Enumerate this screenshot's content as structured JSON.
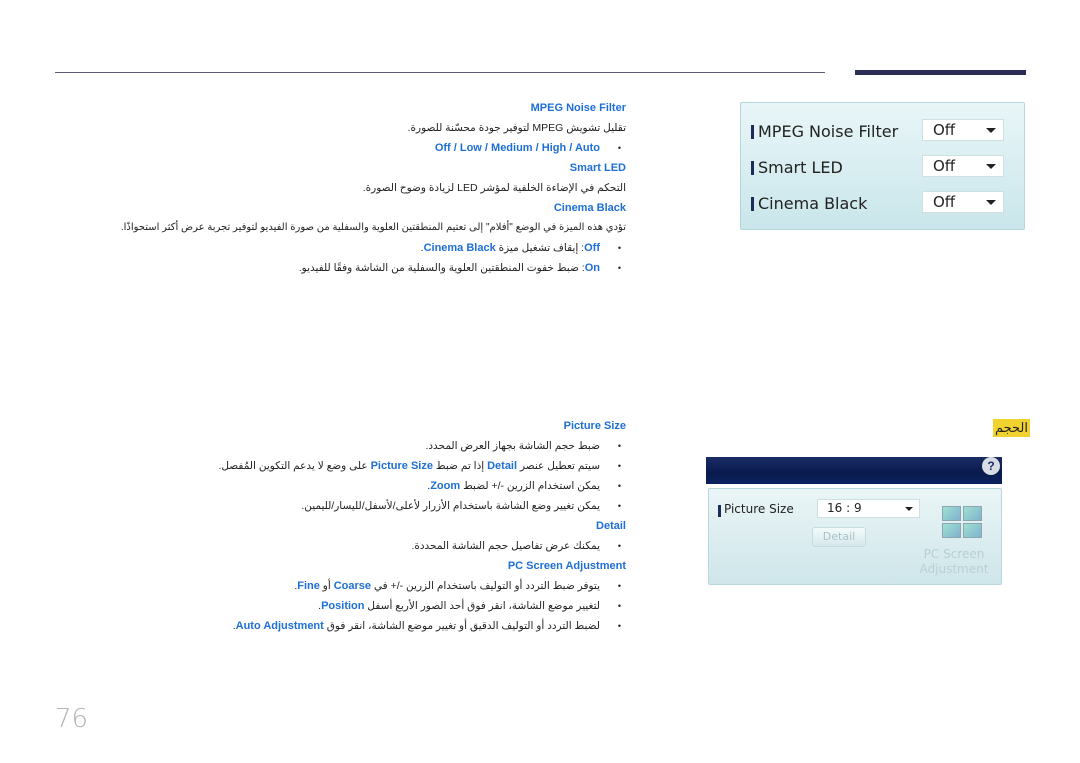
{
  "page_number": "76",
  "section1": {
    "mpeg_heading": "MPEG Noise Filter",
    "mpeg_desc": "تقليل تشويش MPEG لتوفير جودة محسّنة للصورة.",
    "mpeg_options": "Off / Low / Medium / High / Auto",
    "smart_led_heading": "Smart LED",
    "smart_led_desc": "التحكم في الإضاءة الخلفية لمؤشر LED لزيادة وضوح الصورة.",
    "cinema_black_heading": "Cinema Black",
    "cinema_black_desc": "تؤدي هذه الميزة في الوضع \"أفلام\" إلى تعتيم المنطقتين العلوية والسفلية من صورة الفيديو لتوفير تجربة عرض أكثر استحواذًا.",
    "cinema_off_key": "Off",
    "cinema_off_text": ": إيقاف تشغيل ميزة ",
    "cinema_off_feature": "Cinema Black",
    "cinema_on_key": "On",
    "cinema_on_text": ": ضبط خفوت المنطقتين العلوية والسفلية من الشاشة وفقًا للفيديو."
  },
  "panel1": {
    "rows": [
      {
        "label": "MPEG Noise Filter",
        "value": "Off"
      },
      {
        "label": "Smart LED",
        "value": "Off"
      },
      {
        "label": "Cinema Black",
        "value": "Off"
      }
    ]
  },
  "size_highlight": "الحجم",
  "panel2": {
    "help_label": "?",
    "picture_size_label": "Picture Size",
    "picture_size_value": "16 : 9",
    "detail_button": "Detail",
    "pc_screen_label_line1": "PC Screen",
    "pc_screen_label_line2": "Adjustment"
  },
  "section2": {
    "picture_size_heading": "Picture Size",
    "ps_bullet1": "ضبط حجم الشاشة بجهاز العرض المحدد.",
    "ps_bullet2_a": "سيتم تعطيل عنصر ",
    "ps_bullet2_detail": "Detail",
    "ps_bullet2_b": " إذا تم ضبط ",
    "ps_bullet2_ps": "Picture Size",
    "ps_bullet2_c": " على وضع لا يدعم التكوين المُفصل.",
    "ps_bullet3_a": "يمكن استخدام الزرين -/+ لضبط ",
    "ps_bullet3_zoom": "Zoom",
    "ps_bullet4": "يمكن تغيير وضع الشاشة باستخدام الأزرار لأعلى/لأسفل/لليسار/لليمين.",
    "detail_heading": "Detail",
    "detail_bullet1": "يمكنك عرض تفاصيل حجم الشاشة المحددة.",
    "pcsa_heading": "PC Screen Adjustment",
    "pcsa_bullet1_a": "يتوفر ضبط التردد أو التوليف باستخدام الزرين -/+ في ",
    "pcsa_bullet1_coarse": "Coarse",
    "pcsa_bullet1_or": " أو ",
    "pcsa_bullet1_fine": "Fine",
    "pcsa_bullet2_a": "لتغيير موضع الشاشة، انقر فوق أحد الصور الأربع أسفل ",
    "pcsa_bullet2_pos": "Position",
    "pcsa_bullet3_a": "لضبط التردد أو التوليف الدقيق أو تغيير موضع الشاشة، انقر فوق ",
    "pcsa_bullet3_auto": "Auto Adjustment",
    "period": "."
  }
}
